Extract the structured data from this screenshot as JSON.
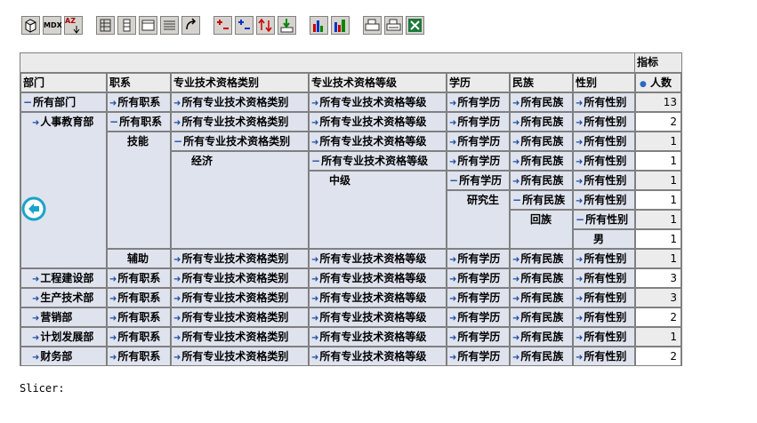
{
  "toolbar": [
    "cube-icon",
    "mdx-icon",
    "sort-icon",
    "hierarchy-icon",
    "column-icon",
    "grid-icon",
    "properties-icon",
    "swap-icon",
    "drill-member-icon",
    "drill-position-icon",
    "drill-replace-icon",
    "drill-through-icon",
    "chart-icon",
    "chart-config-icon",
    "print-config-icon",
    "print-icon",
    "excel-icon"
  ],
  "toolbar_labels": {
    "mdx": "MDX",
    "sort": "AZ"
  },
  "pivot": {
    "measure_header": "指标",
    "measure_name": "人数",
    "headers": [
      "部门",
      "职系",
      "专业技术资格类别",
      "专业技术资格等级",
      "学历",
      "民族",
      "性别"
    ],
    "rows": [
      {
        "cells": [
          "所有部门",
          "所有职系",
          "所有专业技术资格类别",
          "所有专业技术资格等级",
          "所有学历",
          "所有民族",
          "所有性别"
        ],
        "value": "13"
      },
      {
        "cells": [
          "人事教育部",
          "所有职系",
          "所有专业技术资格类别",
          "所有专业技术资格等级",
          "所有学历",
          "所有民族",
          "所有性别"
        ],
        "value": "2"
      },
      {
        "cells": [
          "",
          "技能",
          "所有专业技术资格类别",
          "所有专业技术资格等级",
          "所有学历",
          "所有民族",
          "所有性别"
        ],
        "value": "1"
      },
      {
        "cells": [
          "",
          "",
          "经济",
          "所有专业技术资格等级",
          "所有学历",
          "所有民族",
          "所有性别"
        ],
        "value": "1"
      },
      {
        "cells": [
          "",
          "",
          "",
          "中级",
          "所有学历",
          "所有民族",
          "所有性别"
        ],
        "value": "1"
      },
      {
        "cells": [
          "",
          "",
          "",
          "",
          "研究生",
          "所有民族",
          "所有性别"
        ],
        "value": "1"
      },
      {
        "cells": [
          "",
          "",
          "",
          "",
          "",
          "回族",
          "所有性别"
        ],
        "value": "1"
      },
      {
        "cells": [
          "",
          "",
          "",
          "",
          "",
          "",
          "男"
        ],
        "value": "1"
      },
      {
        "cells": [
          "",
          "辅助",
          "所有专业技术资格类别",
          "所有专业技术资格等级",
          "所有学历",
          "所有民族",
          "所有性别"
        ],
        "value": "1"
      },
      {
        "cells": [
          "工程建设部",
          "所有职系",
          "所有专业技术资格类别",
          "所有专业技术资格等级",
          "所有学历",
          "所有民族",
          "所有性别"
        ],
        "value": "3"
      },
      {
        "cells": [
          "生产技术部",
          "所有职系",
          "所有专业技术资格类别",
          "所有专业技术资格等级",
          "所有学历",
          "所有民族",
          "所有性别"
        ],
        "value": "3"
      },
      {
        "cells": [
          "营销部",
          "所有职系",
          "所有专业技术资格类别",
          "所有专业技术资格等级",
          "所有学历",
          "所有民族",
          "所有性别"
        ],
        "value": "2"
      },
      {
        "cells": [
          "计划发展部",
          "所有职系",
          "所有专业技术资格类别",
          "所有专业技术资格等级",
          "所有学历",
          "所有民族",
          "所有性别"
        ],
        "value": "1"
      },
      {
        "cells": [
          "财务部",
          "所有职系",
          "所有专业技术资格类别",
          "所有专业技术资格等级",
          "所有学历",
          "所有民族",
          "所有性别"
        ],
        "value": "2"
      }
    ]
  },
  "slicer_label": "Slicer:",
  "colors": {
    "row_bg": "#dfe3ee",
    "header_bg": "#ebebeb",
    "border": "#808080",
    "expand": "#1f4fa0",
    "back_icon": "#1aa3c8"
  }
}
